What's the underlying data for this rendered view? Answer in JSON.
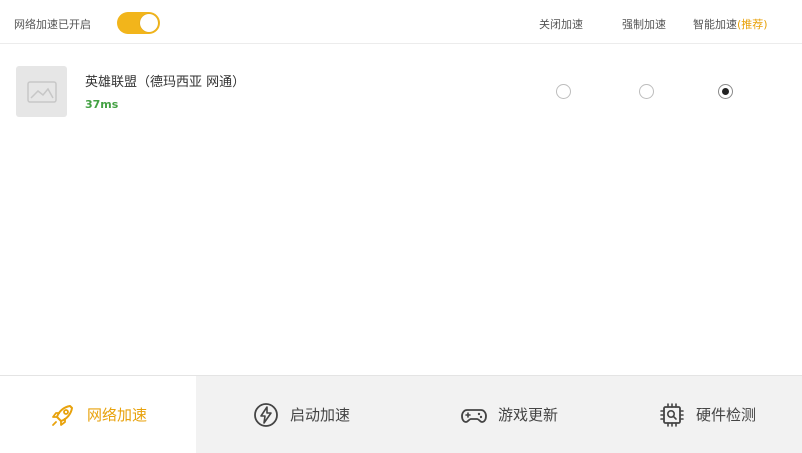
{
  "header": {
    "accel_label": "网络加速已开启",
    "toggle_on": true,
    "modes": {
      "off": "关闭加速",
      "force": "强制加速",
      "smart": "智能加速",
      "smart_recommend": "(推荐)"
    }
  },
  "game": {
    "name": "英雄联盟（德玛西亚 网通）",
    "latency": "37ms",
    "selected_mode": "smart"
  },
  "nav": {
    "items": [
      {
        "label": "网络加速",
        "icon": "rocket-icon",
        "active": true
      },
      {
        "label": "启动加速",
        "icon": "lightning-icon",
        "active": false
      },
      {
        "label": "游戏更新",
        "icon": "gamepad-icon",
        "active": false
      },
      {
        "label": "硬件检测",
        "icon": "chip-icon",
        "active": false
      }
    ]
  },
  "colors": {
    "accent": "#f2b51b",
    "latency_good": "#43a143"
  }
}
